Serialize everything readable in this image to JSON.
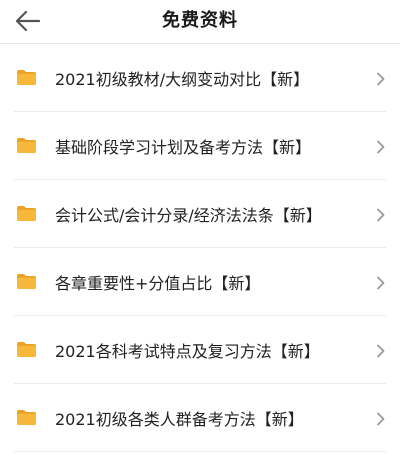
{
  "header": {
    "title": "免费资料",
    "back_icon": "arrow-left-icon"
  },
  "colors": {
    "folder": "#F6B83A",
    "folder_tab": "#E9A323",
    "chevron": "#9a9a9a",
    "divider": "#ececec"
  },
  "items": [
    {
      "label": "2021初级教材/大纲变动对比【新】",
      "icon": "folder-icon"
    },
    {
      "label": "基础阶段学习计划及备考方法【新】",
      "icon": "folder-icon"
    },
    {
      "label": "会计公式/会计分录/经济法法条【新】",
      "icon": "folder-icon"
    },
    {
      "label": "各章重要性+分值占比【新】",
      "icon": "folder-icon"
    },
    {
      "label": "2021各科考试特点及复习方法【新】",
      "icon": "folder-icon"
    },
    {
      "label": "2021初级各类人群备考方法【新】",
      "icon": "folder-icon"
    }
  ]
}
